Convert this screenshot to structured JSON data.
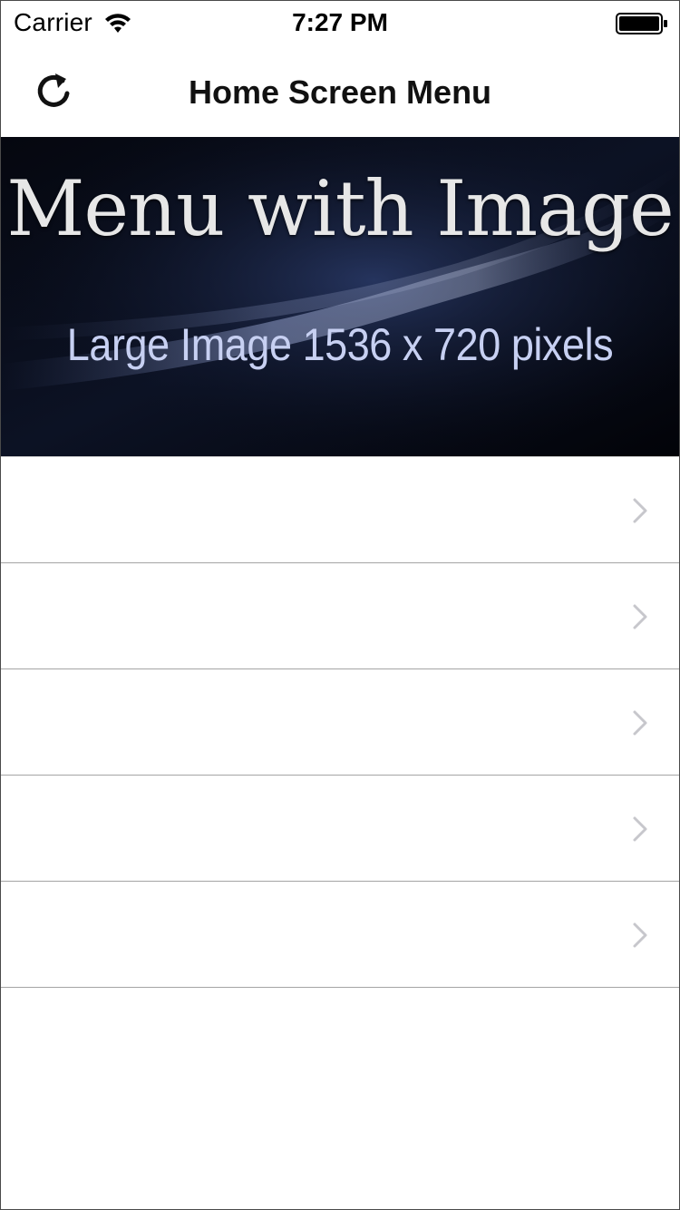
{
  "status_bar": {
    "carrier": "Carrier",
    "time": "7:27 PM",
    "wifi_icon": "wifi-icon",
    "battery_icon": "battery-full-icon"
  },
  "nav_bar": {
    "title": "Home Screen Menu",
    "refresh_icon": "refresh-icon"
  },
  "banner": {
    "title": "Menu with Image",
    "subtitle": "Large Image  1536 x 720 pixels"
  },
  "menu": {
    "items": [
      {
        "label": "",
        "chevron_icon": "chevron-right-icon"
      },
      {
        "label": "",
        "chevron_icon": "chevron-right-icon"
      },
      {
        "label": "",
        "chevron_icon": "chevron-right-icon"
      },
      {
        "label": "",
        "chevron_icon": "chevron-right-icon"
      },
      {
        "label": "",
        "chevron_icon": "chevron-right-icon"
      }
    ]
  },
  "colors": {
    "banner_background": "#04060d",
    "banner_title": "#e7e7e7",
    "banner_subtitle": "#c7d0f2",
    "row_separator": "#a4a4a4",
    "chevron": "#c7c7cc"
  }
}
